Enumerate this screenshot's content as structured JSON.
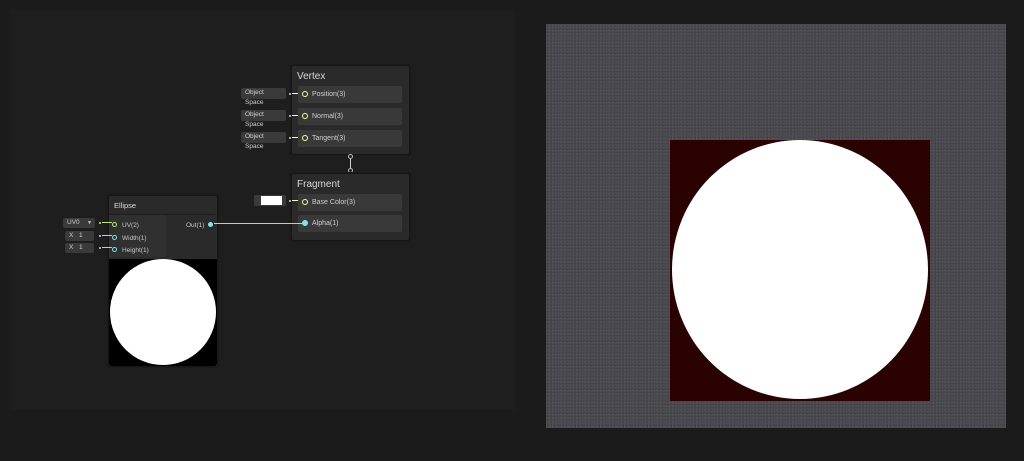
{
  "vertex": {
    "title": "Vertex",
    "slots": [
      {
        "label": "Position(3)",
        "input": "Object Space"
      },
      {
        "label": "Normal(3)",
        "input": "Object Space"
      },
      {
        "label": "Tangent(3)",
        "input": "Object Space"
      }
    ]
  },
  "fragment": {
    "title": "Fragment",
    "slots": [
      {
        "label": "Base Color(3)"
      },
      {
        "label": "Alpha(1)"
      }
    ],
    "base_color_value": "#ffffff"
  },
  "ellipse": {
    "title": "Ellipse",
    "inputs": [
      {
        "label": "UV(2)",
        "field_label": "UV0",
        "has_dropdown": true
      },
      {
        "label": "Width(1)",
        "field_label": "X",
        "value": "1"
      },
      {
        "label": "Height(1)",
        "field_label": "X",
        "value": "1"
      }
    ],
    "output": "Out(1)"
  },
  "preview": {
    "background": "#44444a",
    "square_color": "#2a0202",
    "circle_color": "#ffffff"
  },
  "colors": {
    "wire_uv": "#b6e37a",
    "wire_float": "#84e4e7",
    "wire_vec3": "#f6ff9a"
  }
}
